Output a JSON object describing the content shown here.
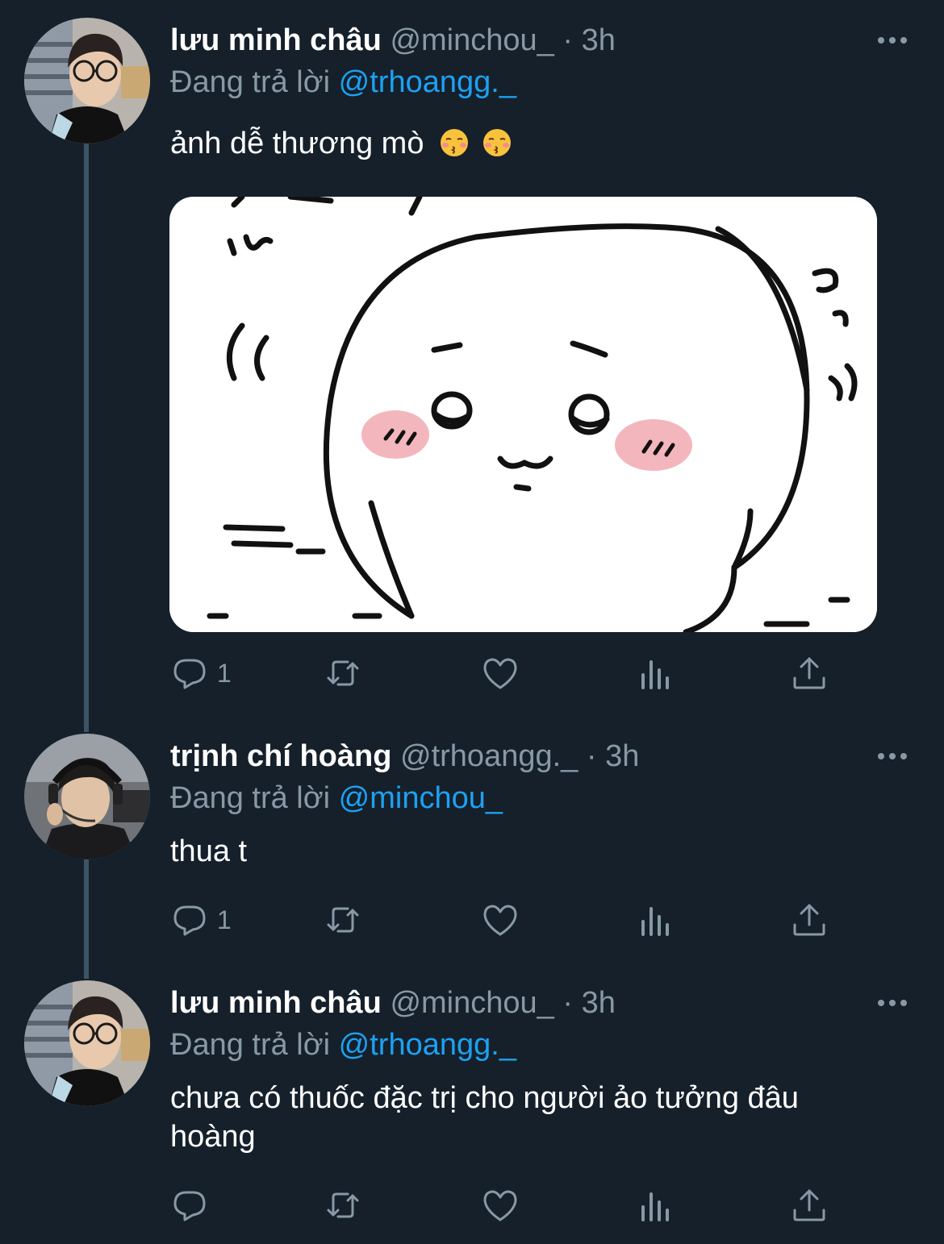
{
  "colors": {
    "background": "#15202b",
    "secondary_text": "#8899a6",
    "link": "#1da1f2",
    "thread_line": "#3d5466"
  },
  "tweets": [
    {
      "name": "lưu minh châu",
      "handle": "@minchou_",
      "separator": "·",
      "time": "3h",
      "replying_prefix": "Đang trả lời",
      "replying_to": "@trhoangg._",
      "text": "ảnh dễ thương mò",
      "emoji": [
        "kissing-face-closed-eyes",
        "kissing-face-closed-eyes"
      ],
      "has_media": true,
      "reply_count": "1"
    },
    {
      "name": "trịnh chí hoàng",
      "handle": "@trhoangg._",
      "separator": "·",
      "time": "3h",
      "replying_prefix": "Đang trả lời",
      "replying_to": "@minchou_",
      "text": "thua t",
      "reply_count": "1"
    },
    {
      "name": "lưu minh châu",
      "handle": "@minchou_",
      "separator": "·",
      "time": "3h",
      "replying_prefix": "Đang trả lời",
      "replying_to": "@trhoangg._",
      "text": "chưa có thuốc đặc trị cho người ảo tưởng đâu hoàng",
      "reply_count": ""
    }
  ],
  "icons": [
    "reply-icon",
    "retweet-icon",
    "like-icon",
    "analytics-icon",
    "share-icon",
    "more-icon"
  ]
}
